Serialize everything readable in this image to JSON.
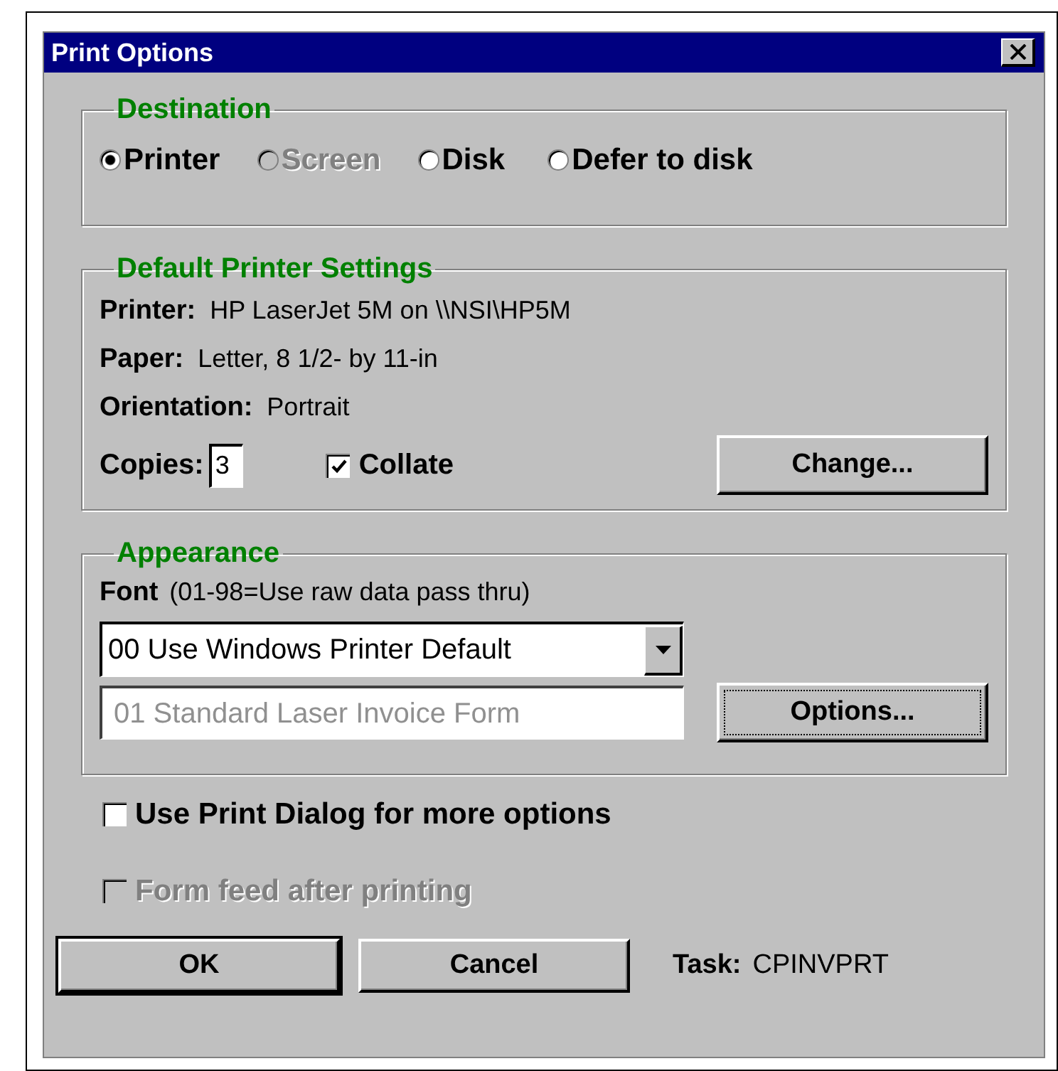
{
  "window": {
    "title": "Print Options"
  },
  "destination": {
    "label": "Destination",
    "options": [
      {
        "label": "Printer",
        "selected": true,
        "disabled": false
      },
      {
        "label": "Screen",
        "selected": false,
        "disabled": true
      },
      {
        "label": "Disk",
        "selected": false,
        "disabled": false
      },
      {
        "label": "Defer to disk",
        "selected": false,
        "disabled": false
      }
    ]
  },
  "printer_settings": {
    "label": "Default Printer Settings",
    "fields": [
      {
        "label": "Printer:",
        "value": "HP LaserJet 5M on \\\\NSI\\HP5M"
      },
      {
        "label": "Paper:",
        "value": "Letter, 8 1/2- by 11-in"
      },
      {
        "label": "Orientation:",
        "value": "Portrait"
      }
    ],
    "copies": {
      "label": "Copies:",
      "value": "3"
    },
    "collate": {
      "label": "Collate",
      "checked": true
    },
    "change_button": {
      "label": "Change..."
    }
  },
  "appearance": {
    "label": "Appearance",
    "font_label": "Font",
    "font_hint": "(01-98=Use raw data pass thru)",
    "font_select": {
      "value": "00 Use Windows Printer Default"
    },
    "form_field": {
      "value": "01 Standard Laser Invoice Form",
      "disabled": true
    },
    "options_button": {
      "label": "Options...",
      "focused": true
    }
  },
  "checkboxes": [
    {
      "label": "Use Print Dialog for more options",
      "checked": false,
      "disabled": false
    },
    {
      "label": "Form feed after printing",
      "checked": false,
      "disabled": true
    }
  ],
  "buttons": [
    {
      "label": "OK",
      "default": true
    },
    {
      "label": "Cancel",
      "default": false
    }
  ],
  "task": {
    "label": "Task:",
    "value": "CPINVPRT"
  }
}
